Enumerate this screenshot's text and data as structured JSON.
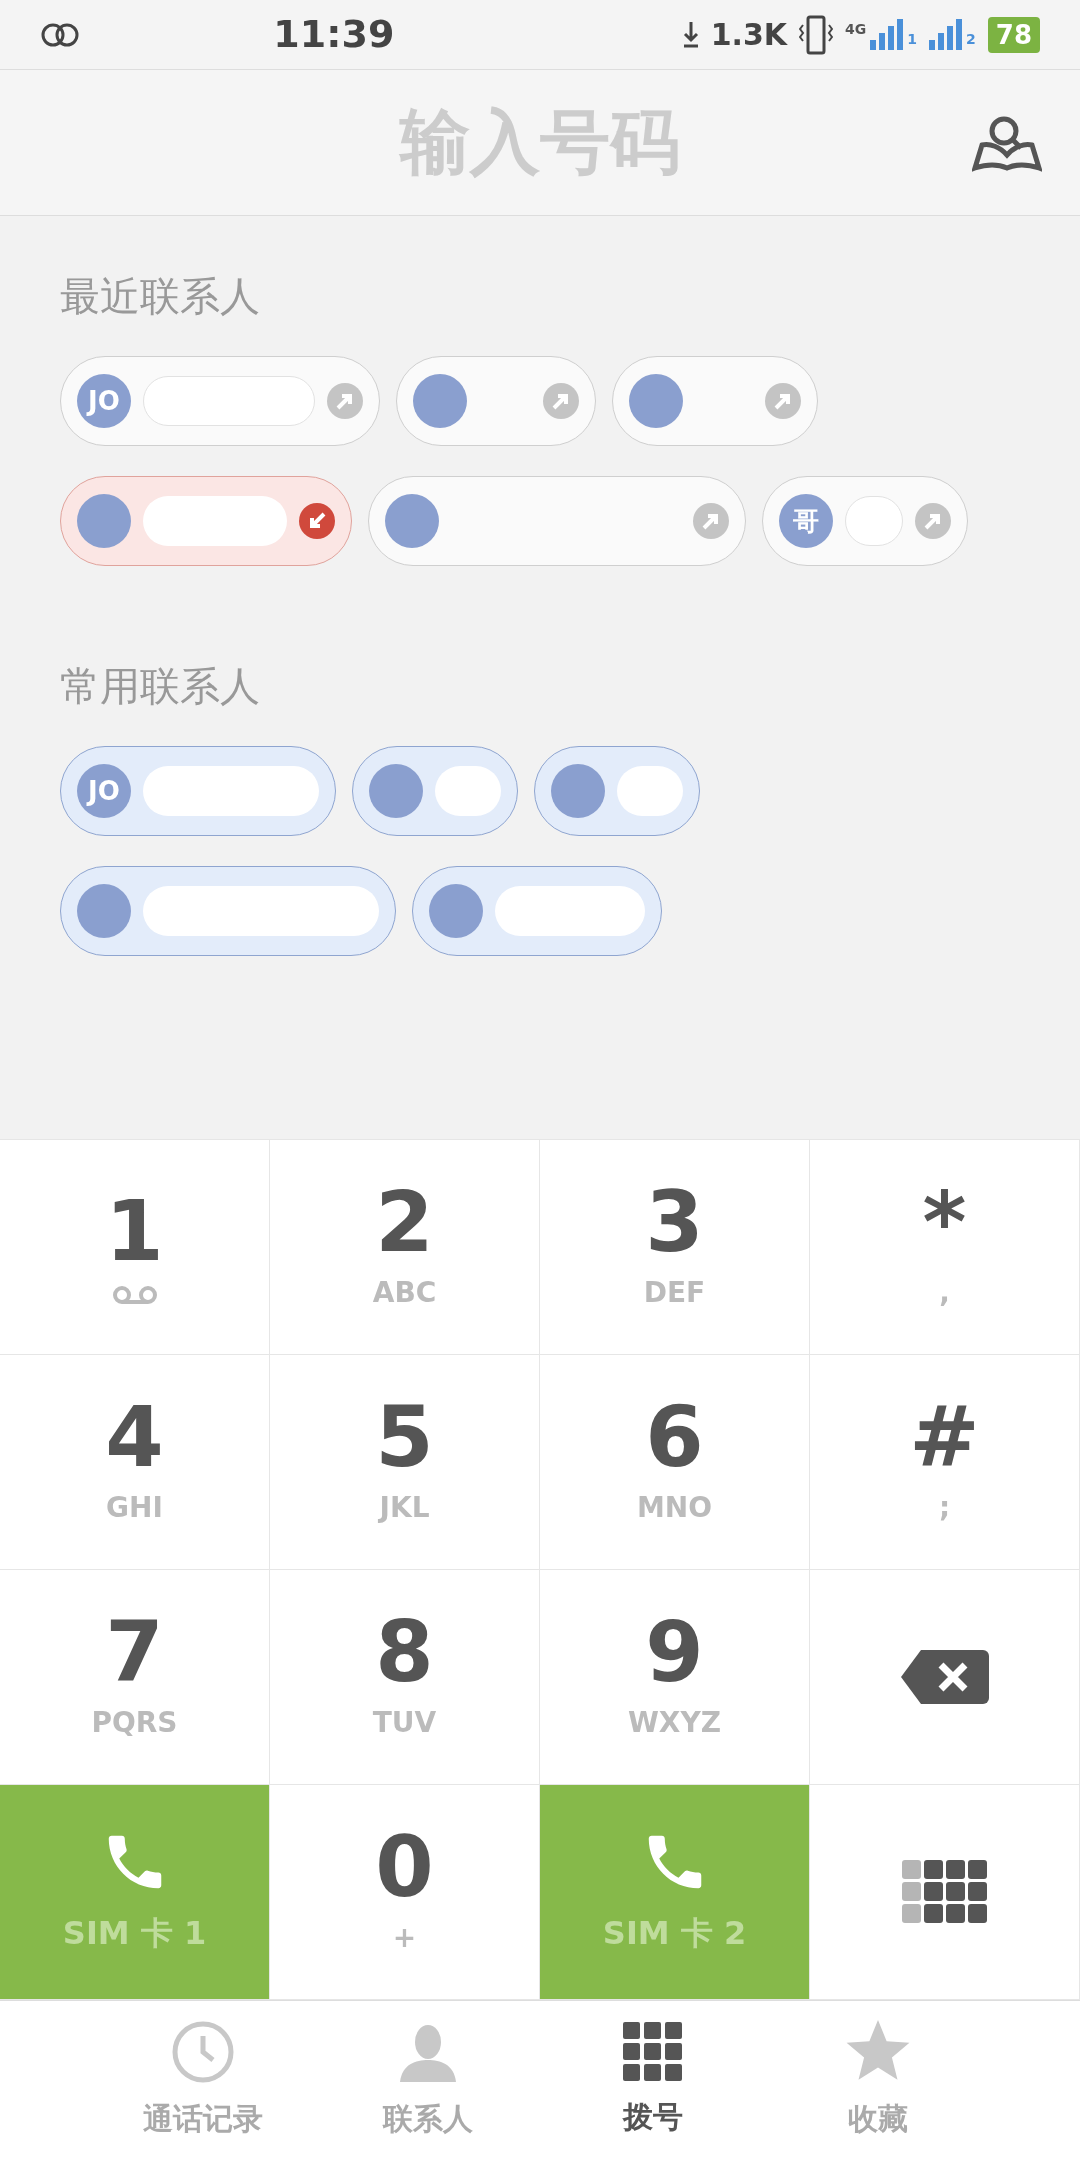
{
  "status_bar": {
    "time": "11:39",
    "net_speed": "1.3K",
    "network": "4G",
    "sim_1": "1",
    "sim_2": "2",
    "battery": "78"
  },
  "header": {
    "title": "输入号码"
  },
  "recent": {
    "title": "最近联系人",
    "contacts": [
      {
        "initials": "JO",
        "kind": "outgoing"
      },
      {
        "kind": "outgoing"
      },
      {
        "kind": "outgoing"
      },
      {
        "kind": "missed"
      },
      {
        "kind": "outgoing"
      },
      {
        "initials": "哥",
        "kind": "outgoing"
      }
    ]
  },
  "frequent": {
    "title": "常用联系人",
    "contacts": [
      {
        "initials": "JO",
        "kind": "frequent"
      },
      {
        "kind": "frequent"
      },
      {
        "kind": "frequent"
      },
      {
        "kind": "frequent"
      },
      {
        "kind": "frequent"
      }
    ]
  },
  "keypad": [
    {
      "kind": "voicemail",
      "digit": "1"
    },
    {
      "kind": "digit",
      "digit": "2",
      "letters": "ABC"
    },
    {
      "kind": "digit",
      "digit": "3",
      "letters": "DEF"
    },
    {
      "kind": "digit",
      "digit": "*",
      "letters": ","
    },
    {
      "kind": "digit",
      "digit": "4",
      "letters": "GHI"
    },
    {
      "kind": "digit",
      "digit": "5",
      "letters": "JKL"
    },
    {
      "kind": "digit",
      "digit": "6",
      "letters": "MNO"
    },
    {
      "kind": "digit",
      "digit": "#",
      "letters": ";"
    },
    {
      "kind": "digit",
      "digit": "7",
      "letters": "PQRS"
    },
    {
      "kind": "digit",
      "digit": "8",
      "letters": "TUV"
    },
    {
      "kind": "digit",
      "digit": "9",
      "letters": "WXYZ"
    },
    {
      "kind": "delete"
    },
    {
      "kind": "call",
      "label": "SIM 卡 1"
    },
    {
      "kind": "digit",
      "digit": "0",
      "letters": "+"
    },
    {
      "kind": "call",
      "label": "SIM 卡 2"
    },
    {
      "kind": "grid"
    }
  ],
  "tabs": [
    {
      "label": "通话记录",
      "selected": false
    },
    {
      "label": "联系人",
      "selected": false
    },
    {
      "label": "拨号",
      "selected": true
    },
    {
      "label": "收藏",
      "selected": false
    }
  ]
}
